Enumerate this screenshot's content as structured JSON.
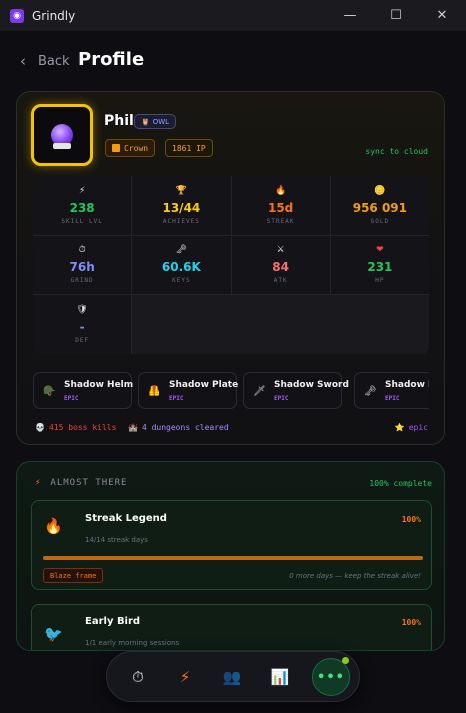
{
  "window": {
    "title": "Grindly",
    "minimize": "—",
    "maximize": "☐",
    "close": "✕"
  },
  "header": {
    "back_label": "Back",
    "back_icon": "‹",
    "title": "Profile"
  },
  "profile": {
    "name": "Phil",
    "badge": "OWL",
    "badge_icon": "🦉",
    "rank": "Crown",
    "ip": "1861 IP",
    "sync": "sync to cloud"
  },
  "stats": [
    {
      "icon": "⚡",
      "value": "238",
      "label": "SKILL LVL",
      "color": "#22c55e"
    },
    {
      "icon": "🏆",
      "value": "13/44",
      "label": "ACHIEVES",
      "color": "#facc15"
    },
    {
      "icon": "🔥",
      "value": "15d",
      "label": "STREAK",
      "color": "#f97316"
    },
    {
      "icon": "🪙",
      "value": "956 091",
      "label": "GOLD",
      "color": "#f59e0b"
    },
    {
      "icon": "⏱",
      "value": "76h",
      "label": "GRIND",
      "color": "#818cf8"
    },
    {
      "icon": "🗝",
      "value": "60.6K",
      "label": "KEYS",
      "color": "#22d3ee"
    },
    {
      "icon": "⚔",
      "value": "84",
      "label": "ATK",
      "color": "#f87171"
    },
    {
      "icon": "❤",
      "value": "231",
      "label": "HP",
      "color": "#22c55e"
    },
    {
      "icon": "🛡",
      "value": "-",
      "label": "DEF",
      "color": "#818cf8"
    }
  ],
  "gear": [
    {
      "icon": "🪖",
      "name": "Shadow Helm",
      "rarity": "EPIC"
    },
    {
      "icon": "🦺",
      "name": "Shadow Plate",
      "rarity": "EPIC"
    },
    {
      "icon": "🗡",
      "name": "Shadow Sword",
      "rarity": "EPIC"
    },
    {
      "icon": "🗝",
      "name": "Shadow L",
      "rarity": "EPIC"
    }
  ],
  "footer": {
    "boss_icon": "💀",
    "boss_kills": "415 boss kills",
    "dungeon_icon": "🏰",
    "dungeons": "4 dungeons cleared",
    "tier_icon": "⭐",
    "tier": "epic"
  },
  "almost_there": {
    "title": "ALMOST THERE",
    "icon": "⚡",
    "complete": "100% complete",
    "items": [
      {
        "icon": "🔥",
        "name": "Streak Legend",
        "pct": "100%",
        "sub": "14/14 streak days",
        "progress": 1.0,
        "reward": "Blaze frame",
        "hint": "0 more days — keep the streak alive!"
      },
      {
        "icon": "🐦",
        "name": "Early Bird",
        "pct": "100%",
        "sub": "1/1 early morning sessions"
      }
    ]
  },
  "dock": {
    "timer": "⏱",
    "skills": "⚡",
    "party": "👥",
    "stats": "📊",
    "more": "•••"
  }
}
